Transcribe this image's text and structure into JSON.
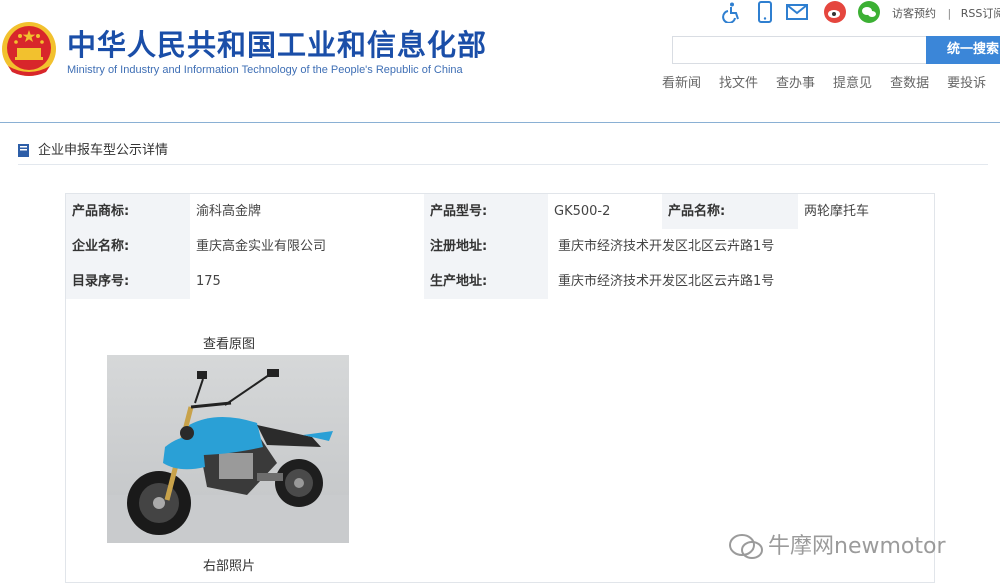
{
  "header": {
    "title_cn": "中华人民共和国工业和信息化部",
    "title_en": "Ministry of Industry and Information Technology of the People's Republic of China",
    "utility_icons": [
      "accessibility-icon",
      "mobile-icon",
      "mail-icon",
      "weibo-icon",
      "wechat-icon"
    ],
    "appointment_label": "访客预约",
    "separator": "|",
    "rss_label": "RSS订阅",
    "search_placeholder": "",
    "search_button": "统一搜索",
    "quick_links": [
      "看新闻",
      "找文件",
      "查办事",
      "提意见",
      "查数据",
      "要投诉"
    ]
  },
  "section": {
    "title": "企业申报车型公示详情"
  },
  "detail": {
    "brand_label": "产品商标:",
    "brand_value": "渝科高金牌",
    "model_label": "产品型号:",
    "model_value": "GK500-2",
    "name_label": "产品名称:",
    "name_value": "两轮摩托车",
    "company_label": "企业名称:",
    "company_value": "重庆高金实业有限公司",
    "reg_addr_label": "注册地址:",
    "reg_addr_value": "重庆市经济技术开发区北区云卉路1号",
    "catalog_label": "目录序号:",
    "catalog_value": "175",
    "prod_addr_label": "生产地址:",
    "prod_addr_value": "重庆市经济技术开发区北区云卉路1号",
    "view_original": "查看原图",
    "photo_caption": "右部照片"
  },
  "watermark": {
    "text": "牛摩网newmotor"
  },
  "colors": {
    "brand_blue": "#1a4ea8",
    "search_button": "#3b86d8",
    "label_bg": "#f2f4f7",
    "emblem_red": "#d8262b",
    "emblem_gold": "#f2c12e",
    "motorcycle_blue": "#2aa0d6"
  }
}
